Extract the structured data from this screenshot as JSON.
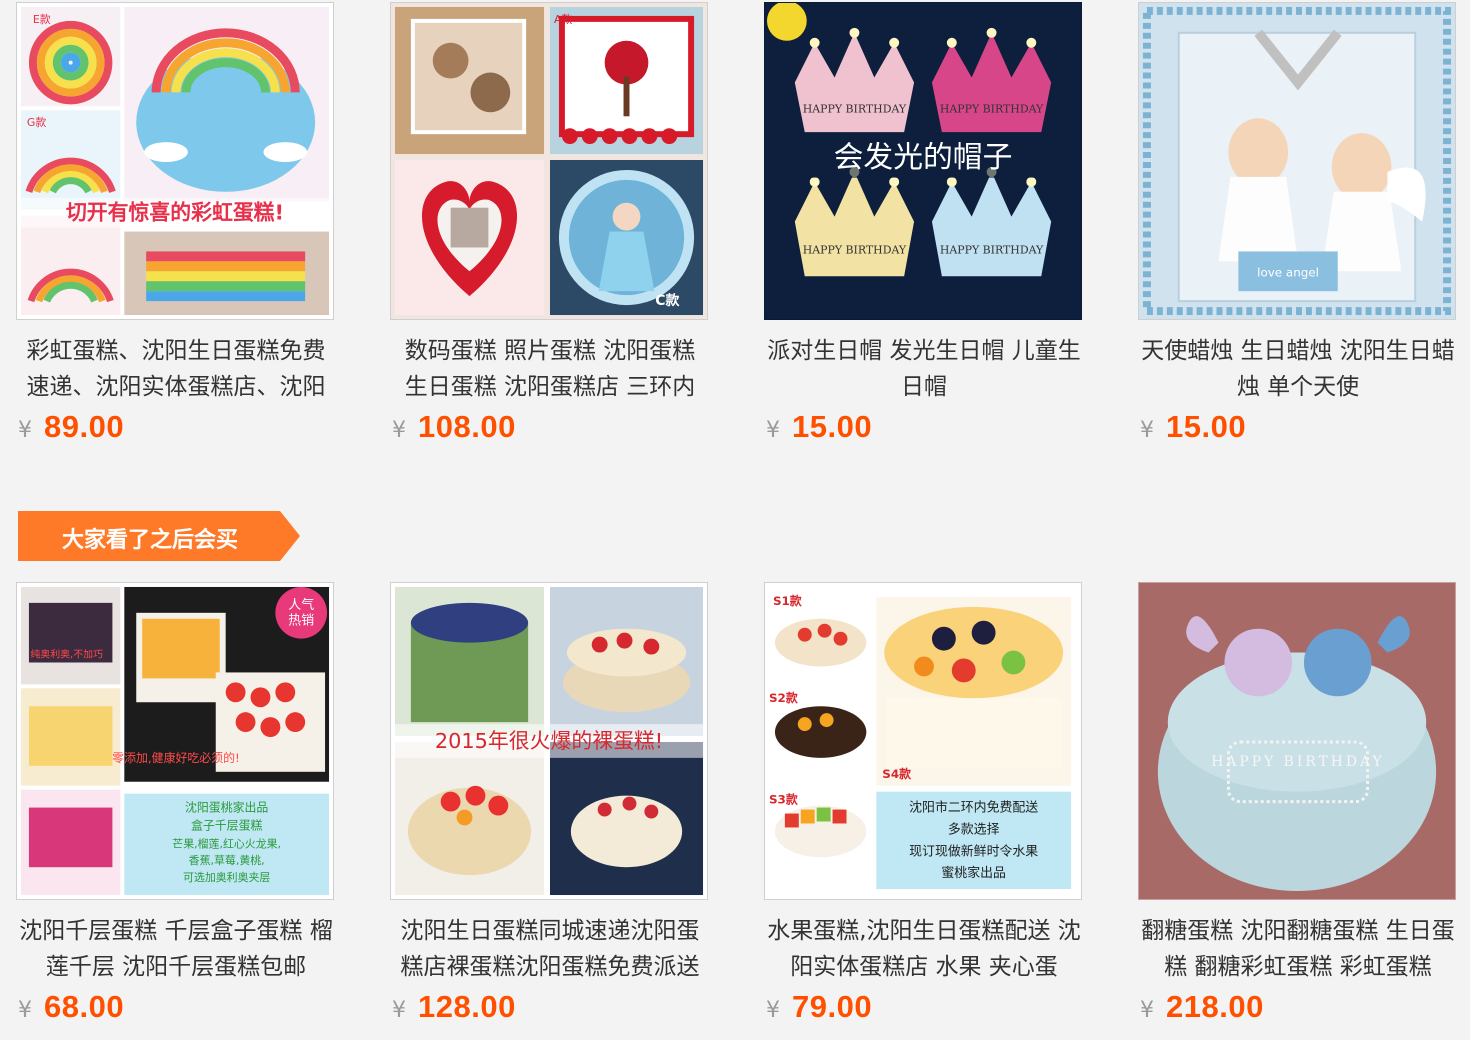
{
  "row1": [
    {
      "title": "彩虹蛋糕、沈阳生日蛋糕免费速递、沈阳实体蛋糕店、沈阳",
      "currency": "¥",
      "price": "89.00",
      "image_texts": [
        "切开有惊喜的彩虹蛋糕!",
        "E款",
        "G款"
      ]
    },
    {
      "title": "数码蛋糕 照片蛋糕 沈阳蛋糕 生日蛋糕 沈阳蛋糕店 三环内",
      "currency": "¥",
      "price": "108.00",
      "image_texts": [
        "A款",
        "C款"
      ]
    },
    {
      "title": "派对生日帽 发光生日帽 儿童生日帽",
      "currency": "¥",
      "price": "15.00",
      "image_texts": [
        "会发光的帽子",
        "HAPPY BIRTHDAY"
      ]
    },
    {
      "title": "天使蜡烛 生日蜡烛 沈阳生日蜡烛 单个天使",
      "currency": "¥",
      "price": "15.00",
      "image_texts": [
        "love angel"
      ]
    }
  ],
  "section": {
    "label": "大家看了之后会买"
  },
  "row2": [
    {
      "title": "沈阳千层蛋糕 千层盒子蛋糕 榴莲千层 沈阳千层蛋糕包邮",
      "currency": "¥",
      "price": "68.00",
      "image_texts": [
        "人气热销",
        "纯奥利奥,不加巧",
        "零添加,健康好吃必须的!",
        "沈阳蛋桃家出品",
        "盒子千层蛋糕",
        "芒果,榴莲,红心火龙果,",
        "香蕉,草莓,黄桃,",
        "可选加奥利奥夹层"
      ]
    },
    {
      "title": "沈阳生日蛋糕同城速递沈阳蛋糕店裸蛋糕沈阳蛋糕免费派送",
      "currency": "¥",
      "price": "128.00",
      "image_texts": [
        "2015年很火爆的裸蛋糕!"
      ]
    },
    {
      "title": "水果蛋糕,沈阳生日蛋糕配送 沈阳实体蛋糕店 水果 夹心蛋",
      "currency": "¥",
      "price": "79.00",
      "image_texts": [
        "S1款",
        "S2款",
        "S3款",
        "S4款",
        "沈阳市二环内免费配送",
        "多款选择",
        "现订现做新鲜时令水果",
        "蜜桃家出品"
      ]
    },
    {
      "title": "翻糖蛋糕 沈阳翻糖蛋糕 生日蛋糕 翻糖彩虹蛋糕 彩虹蛋糕",
      "currency": "¥",
      "price": "218.00",
      "image_texts": [
        "HAPPY BIRTHDAY"
      ]
    }
  ]
}
